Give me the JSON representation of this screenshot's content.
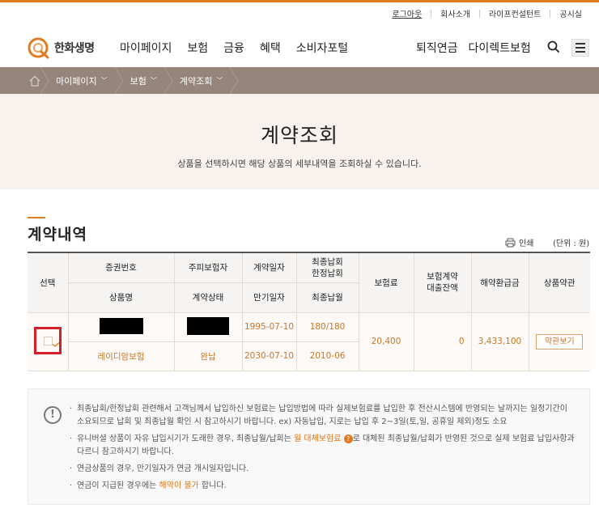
{
  "util_links": [
    "로그아웃",
    "회사소개",
    "라이프컨설턴트",
    "공시실"
  ],
  "logo": {
    "text": "한화생명"
  },
  "nav": {
    "main": [
      "마이페이지",
      "보험",
      "금융",
      "혜택",
      "소비자포털"
    ],
    "right": [
      "퇴직연금",
      "다이렉트보험"
    ]
  },
  "breadcrumb": [
    "마이페이지",
    "보험",
    "계약조회"
  ],
  "hero": {
    "title": "계약조회",
    "desc": "상품을 선택하시면 해당 상품의 세부내역을 조회하실 수 있습니다."
  },
  "section": {
    "title": "계약내역",
    "print_label": "인쇄",
    "unit_label": "(단위 : 원)"
  },
  "table": {
    "headers": {
      "select": "선택",
      "policy_no": "증권번호",
      "insured": "주피보험자",
      "contract_date": "계약일자",
      "last_paid_1": "최종납회",
      "last_paid_2": "한정납회",
      "premium": "보험료",
      "loan_1": "보험계약",
      "loan_2": "대출잔액",
      "refund": "해약환급금",
      "terms": "상품약관",
      "product": "상품명",
      "status": "계약상태",
      "maturity": "만기일자",
      "last_month": "최종납월"
    },
    "rows": [
      {
        "contract_date": "1995-07-10",
        "paid_count": "180/180",
        "premium": "20,400",
        "loan_balance": "0",
        "refund": "3,433,100",
        "terms_button": "약관보기",
        "product": "레이디암보험",
        "status": "완납",
        "maturity": "2030-07-10",
        "last_month": "2010-06"
      }
    ]
  },
  "notice": {
    "item1": "최종납회/한정납회 관련해서 고객님께서 납입하신 보험료는 납입방법에 따라 실제보험료를 납입한 후 전산시스템에 반영되는 날까지는 일정기간이 소요되므로 납회 및 최종납월 확인 시 참고하시기 바랍니다. ex) 자동납입, 지로는 납입 후 2~3일(토,일, 공휴일 제외)정도 소요",
    "item2_a": "유니버셜 상품이 자유 납입시기가 도래한 경우, 최종납월/납회는 ",
    "item2_link": "월 대체보험료",
    "item2_b": "로 대체된 최종납월/납회가 반영된 것으로 실제 보험료 납입사항과 다르니 참고하시기 바랍니다.",
    "item3": "연금상품의 경우, 만기일자가 연금 개시일자입니다.",
    "item4_a": "연금이 지급된 경우에는 ",
    "item4_link": "해약이 불가",
    "item4_b": " 합니다."
  },
  "colors": {
    "accent": "#e07a1f",
    "breadcrumb_bg": "#96857a",
    "hero_bg": "#f8f2ee"
  }
}
